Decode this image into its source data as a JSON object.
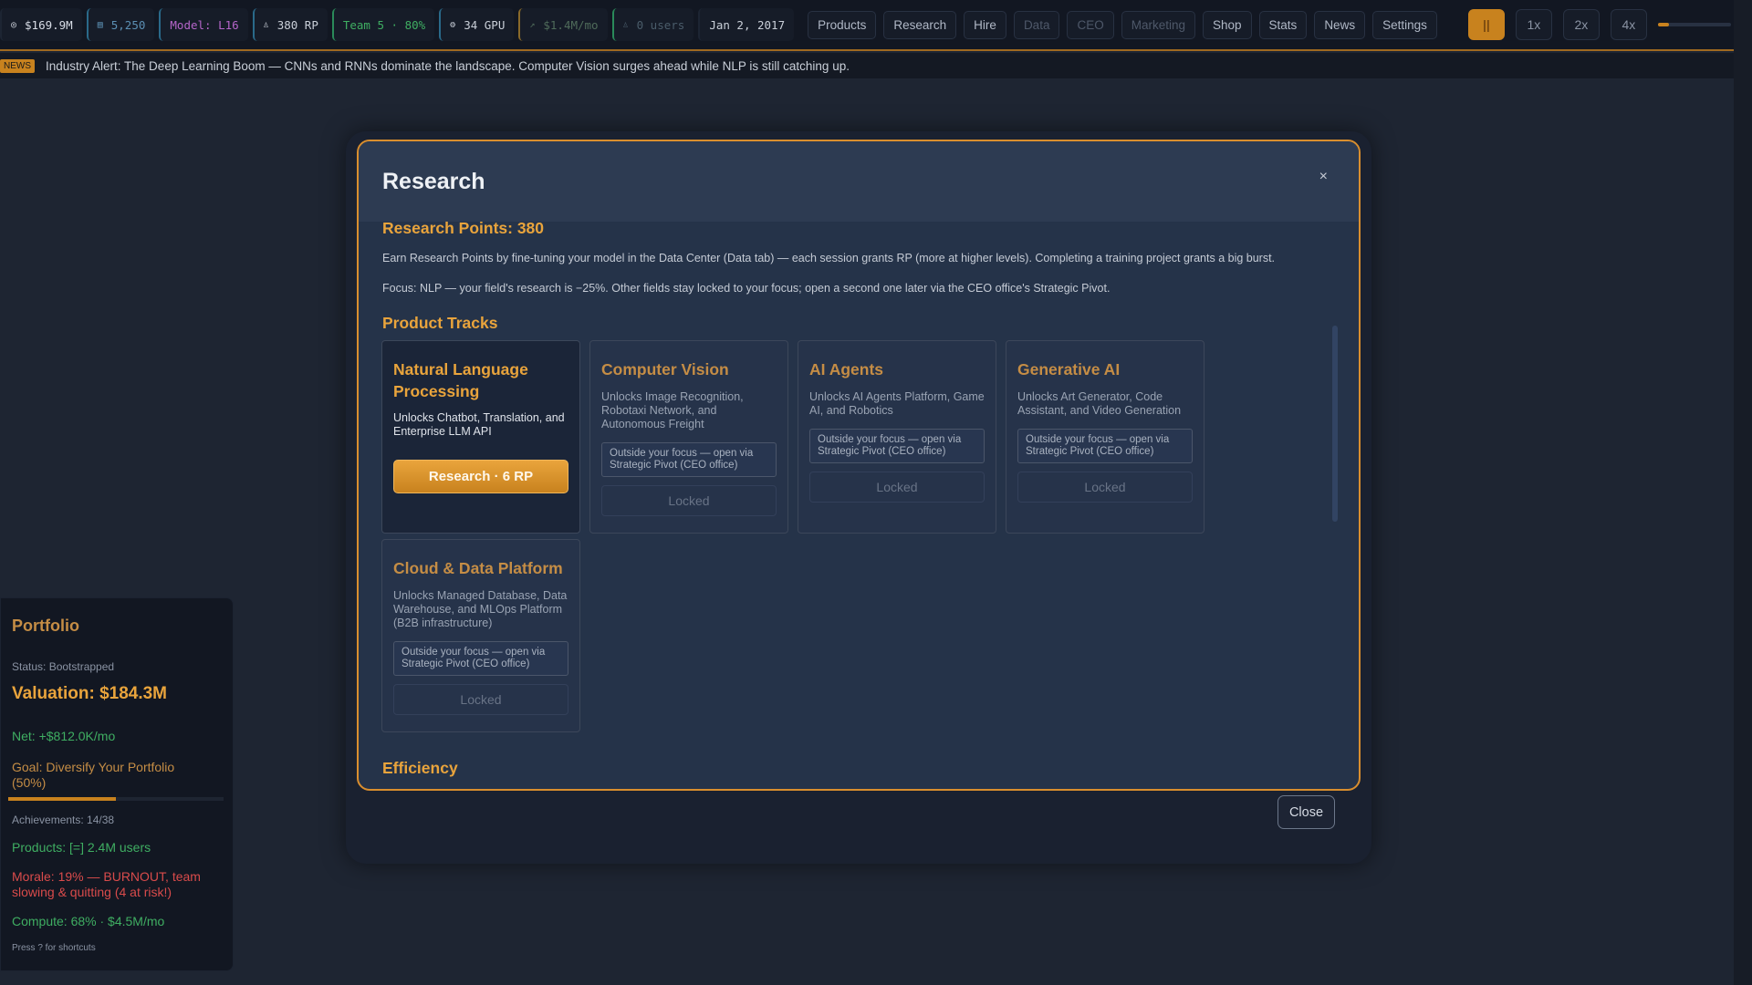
{
  "topbar": {
    "stats": [
      {
        "icon": "coin-icon",
        "glyph": "◎",
        "value": "$169.9M",
        "color": "#d8dde6",
        "border": "#1d2533"
      },
      {
        "icon": "data-icon",
        "glyph": "▤",
        "value": "5,250",
        "color": "#5b8fb3",
        "border": "#2a6a8a"
      },
      {
        "icon": "model-icon",
        "glyph": "",
        "value": "Model: L16",
        "color": "#b565c9",
        "border": "#2a6a8a"
      },
      {
        "icon": "research-icon",
        "glyph": "♙",
        "value": "380 RP",
        "color": "#c9cfd8",
        "border": "#2a6a8a"
      },
      {
        "icon": "team-icon",
        "glyph": "",
        "value": "Team 5 · 80%",
        "color": "#3fae62",
        "border": "#2a8a5a"
      },
      {
        "icon": "gpu-icon",
        "glyph": "⚙",
        "value": "34 GPU",
        "color": "#c9cfd8",
        "border": "#2a6a8a"
      },
      {
        "icon": "trend-up-icon",
        "glyph": "↗",
        "value": "$1.4M/mo",
        "color": "#4f6b5a",
        "border": "#8a6a2a"
      },
      {
        "icon": "user-icon",
        "glyph": "♙",
        "value": "0 users",
        "color": "#4a5c6a",
        "border": "#2a8a5a"
      },
      {
        "icon": "",
        "glyph": "",
        "value": "Jan 2, 2017",
        "color": "#c9cfd8",
        "border": "#1d2533"
      }
    ],
    "nav": [
      {
        "label": "Products",
        "dim": false
      },
      {
        "label": "Research",
        "dim": false
      },
      {
        "label": "Hire",
        "dim": false
      },
      {
        "label": "Data",
        "dim": true
      },
      {
        "label": "CEO",
        "dim": true
      },
      {
        "label": "Marketing",
        "dim": true
      },
      {
        "label": "Shop",
        "dim": false
      },
      {
        "label": "Stats",
        "dim": false
      },
      {
        "label": "News",
        "dim": false
      },
      {
        "label": "Settings",
        "dim": false
      }
    ],
    "pause_glyph": "||",
    "speeds": [
      "1x",
      "2x",
      "4x"
    ],
    "volume_level": 0.15
  },
  "ticker": {
    "badge": "NEWS",
    "text": "Industry Alert: The Deep Learning Boom — CNNs and RNNs dominate the landscape. Computer Vision surges ahead while NLP is still catching up."
  },
  "portfolio": {
    "title": "Portfolio",
    "status": "Status: Bootstrapped",
    "valuation": "Valuation: $184.3M",
    "net": "Net: +$812.0K/mo",
    "goal": "Goal: Diversify Your Portfolio (50%)",
    "goal_progress": 0.5,
    "achievements": "Achievements: 14/38",
    "products": "Products: [=] 2.4M users",
    "morale": "Morale: 19% — BURNOUT, team slowing & quitting (4 at risk!)",
    "compute": "Compute: 68% · $4.5M/mo",
    "shortcut_hint": "Press ? for shortcuts"
  },
  "modal": {
    "title": "Research",
    "close_glyph": "×",
    "points_label": "Research Points: 380",
    "info1": "Earn Research Points by fine-tuning your model in the Data Center (Data tab) — each session grants RP (more at higher levels). Completing a training project grants a big burst.",
    "info2": "Focus: NLP — your field's research is −25%. Other fields stay locked to your focus; open a second one later via the CEO office's Strategic Pivot.",
    "section_tracks": "Product Tracks",
    "section_efficiency": "Efficiency",
    "tracks": [
      {
        "name": "Natural Language Processing",
        "desc": "Unlocks Chatbot, Translation, and Enterprise LLM API",
        "button": "Research  ·  6 RP"
      },
      {
        "name": "Computer Vision",
        "desc": "Unlocks Image Recognition, Robotaxi Network, and Autonomous Freight",
        "warning": "Outside your focus — open via Strategic Pivot (CEO office)",
        "locked": "Locked"
      },
      {
        "name": "AI Agents",
        "desc": "Unlocks AI Agents Platform, Game AI, and Robotics",
        "warning": "Outside your focus — open via Strategic Pivot (CEO office)",
        "locked": "Locked"
      },
      {
        "name": "Generative AI",
        "desc": "Unlocks Art Generator, Code Assistant, and Video Generation",
        "warning": "Outside your focus — open via Strategic Pivot (CEO office)",
        "locked": "Locked"
      },
      {
        "name": "Cloud & Data Platform",
        "desc": "Unlocks Managed Database, Data Warehouse, and MLOps Platform (B2B infrastructure)",
        "warning": "Outside your focus — open via Strategic Pivot (CEO office)",
        "locked": "Locked"
      }
    ],
    "close_label": "Close"
  },
  "colors": {
    "accent": "#e9a43c",
    "modal_border": "#d98e2e",
    "positive": "#3fae62",
    "danger": "#d94b4b"
  }
}
